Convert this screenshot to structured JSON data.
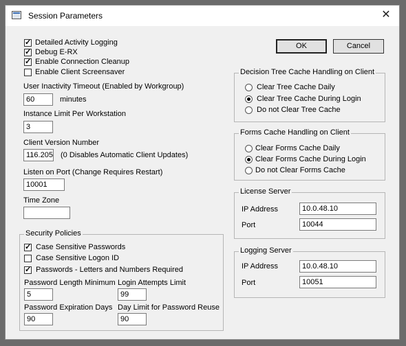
{
  "window": {
    "title": "Session Parameters",
    "icon": "window-icon",
    "close_icon": "close-icon"
  },
  "buttons": {
    "ok": "OK",
    "cancel": "Cancel"
  },
  "options": [
    {
      "label": "Detailed Activity Logging",
      "checked": true
    },
    {
      "label": "Debug E-RX",
      "checked": true
    },
    {
      "label": "Enable Connection Cleanup",
      "checked": true
    },
    {
      "label": "Enable Client Screensaver",
      "checked": false
    }
  ],
  "inactivity": {
    "label": "User Inactivity Timeout (Enabled by Workgroup)",
    "value": "60",
    "unit": "minutes"
  },
  "instance_limit": {
    "label": "Instance Limit Per Workstation",
    "value": "3"
  },
  "client_version": {
    "label": "Client Version Number",
    "value": "116.205",
    "note": "(0 Disables Automatic Client Updates)"
  },
  "listen_port": {
    "label": "Listen on Port (Change Requires Restart)",
    "value": "10001"
  },
  "time_zone": {
    "label": "Time Zone",
    "value": ""
  },
  "security": {
    "title": "Security Policies",
    "checks": [
      {
        "label": "Case Sensitive Passwords",
        "checked": true
      },
      {
        "label": "Case Sensitive Logon ID",
        "checked": false
      },
      {
        "label": "Passwords - Letters and Numbers Required",
        "checked": true
      }
    ],
    "pwd_min": {
      "label": "Password Length Minimum",
      "value": "5"
    },
    "login_attempts": {
      "label": "Login Attempts Limit",
      "value": "99"
    },
    "pwd_expiration": {
      "label": "Password Expiration Days",
      "value": "90"
    },
    "pwd_reuse": {
      "label": "Day Limit for Password Reuse",
      "value": "90"
    }
  },
  "decision_cache": {
    "title": "Decision Tree Cache Handling on Client",
    "options": [
      "Clear Tree Cache Daily",
      "Clear Tree Cache During Login",
      "Do not Clear Tree Cache"
    ],
    "selected": 1
  },
  "forms_cache": {
    "title": "Forms Cache Handling on Client",
    "options": [
      "Clear Forms Cache Daily",
      "Clear Forms Cache During Login",
      "Do not Clear Forms Cache"
    ],
    "selected": 1
  },
  "license_server": {
    "title": "License Server",
    "ip_label": "IP Address",
    "ip": "10.0.48.10",
    "port_label": "Port",
    "port": "10044"
  },
  "logging_server": {
    "title": "Logging Server",
    "ip_label": "IP Address",
    "ip": "10.0.48.10",
    "port_label": "Port",
    "port": "10051"
  }
}
